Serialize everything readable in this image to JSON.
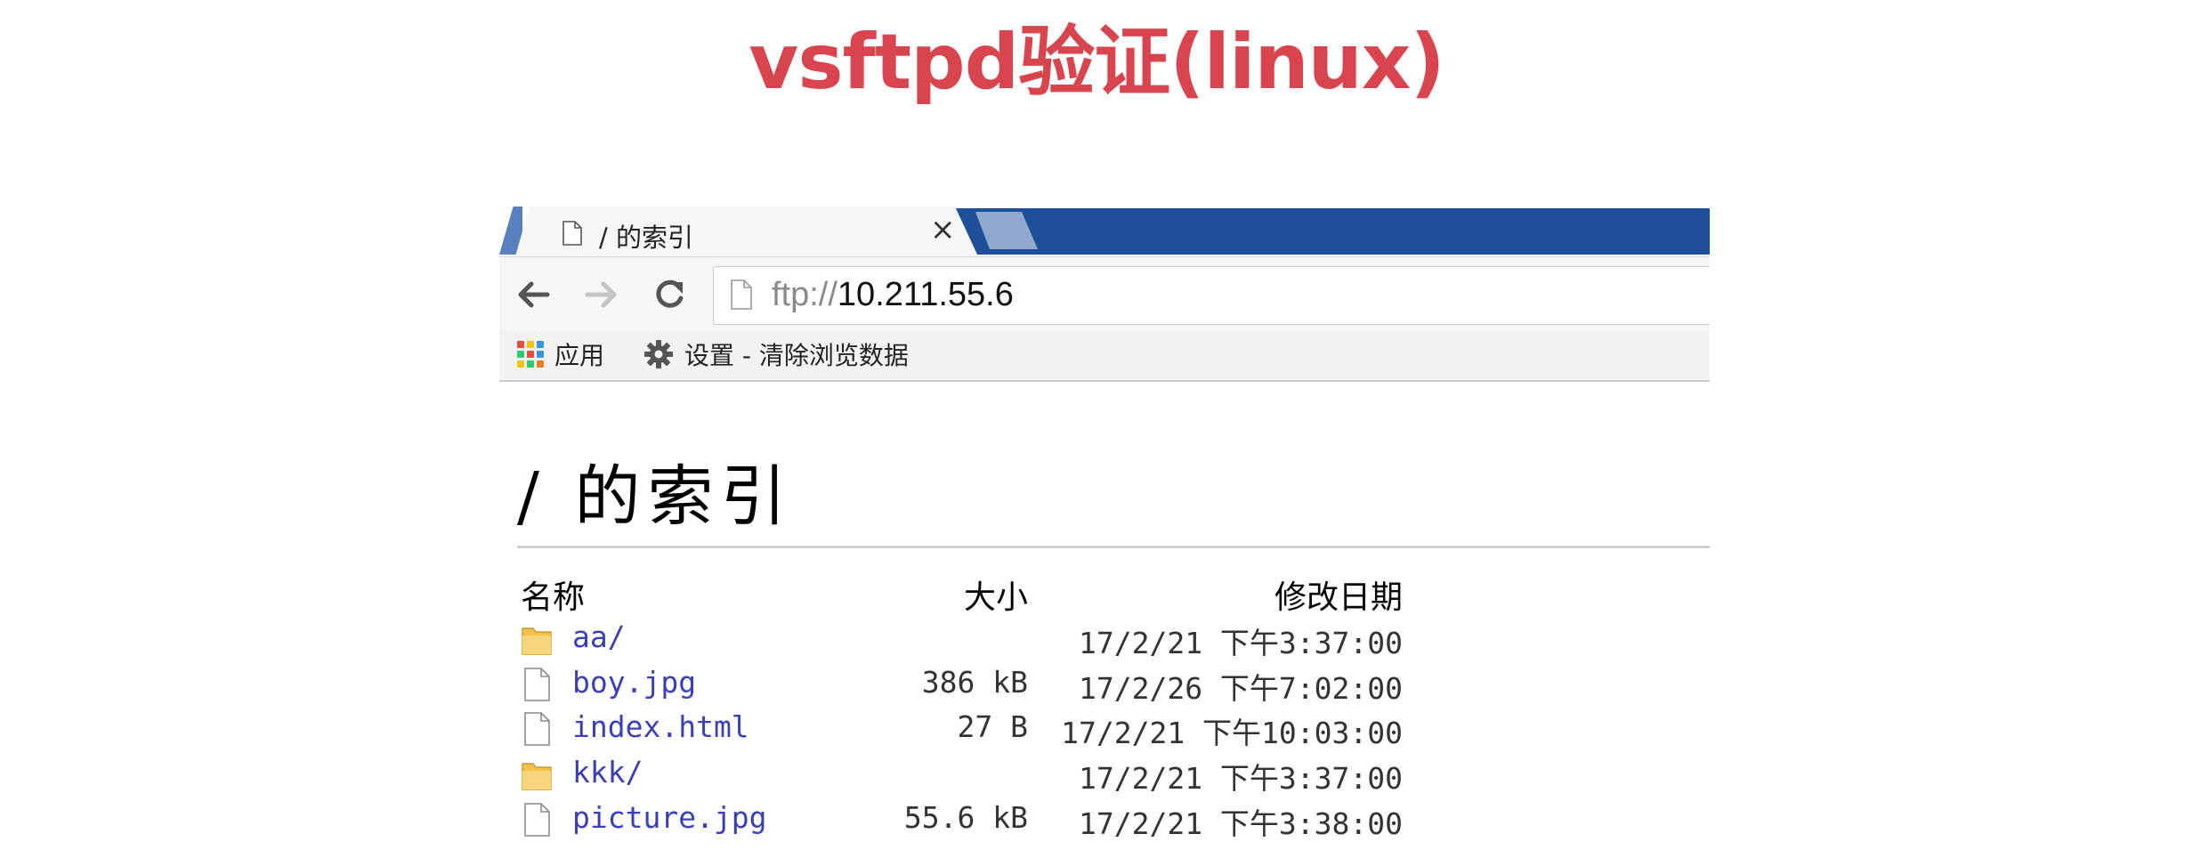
{
  "slide": {
    "title": "vsftpd验证(linux)"
  },
  "browser": {
    "tab": {
      "title": "/ 的索引",
      "close": "×"
    },
    "omnibox": {
      "scheme": "ftp://",
      "host": "10.211.55.6"
    },
    "bookmarks": [
      {
        "label": "应用",
        "icon": "apps-grid-icon"
      },
      {
        "label": "设置 - 清除浏览数据",
        "icon": "gear-icon"
      }
    ]
  },
  "page": {
    "heading": "/ 的索引",
    "columns": {
      "name": "名称",
      "size": "大小",
      "modified": "修改日期"
    },
    "files": [
      {
        "name": "aa/",
        "size": "",
        "modified": "17/2/21 下午3:37:00",
        "icon": "folder-icon"
      },
      {
        "name": "boy.jpg",
        "size": "386 kB",
        "modified": "17/2/26 下午7:02:00",
        "icon": "file-icon"
      },
      {
        "name": "index.html",
        "size": "27 B",
        "modified": "17/2/21 下午10:03:00",
        "icon": "file-icon"
      },
      {
        "name": "kkk/",
        "size": "",
        "modified": "17/2/21 下午3:37:00",
        "icon": "folder-icon"
      },
      {
        "name": "picture.jpg",
        "size": "55.6 kB",
        "modified": "17/2/21 下午3:38:00",
        "icon": "file-icon"
      }
    ]
  },
  "colors": {
    "title": "#d8454f",
    "tabstrip": "#1f4f99",
    "link": "#3a3fb8",
    "folder": "#f2c14e"
  }
}
